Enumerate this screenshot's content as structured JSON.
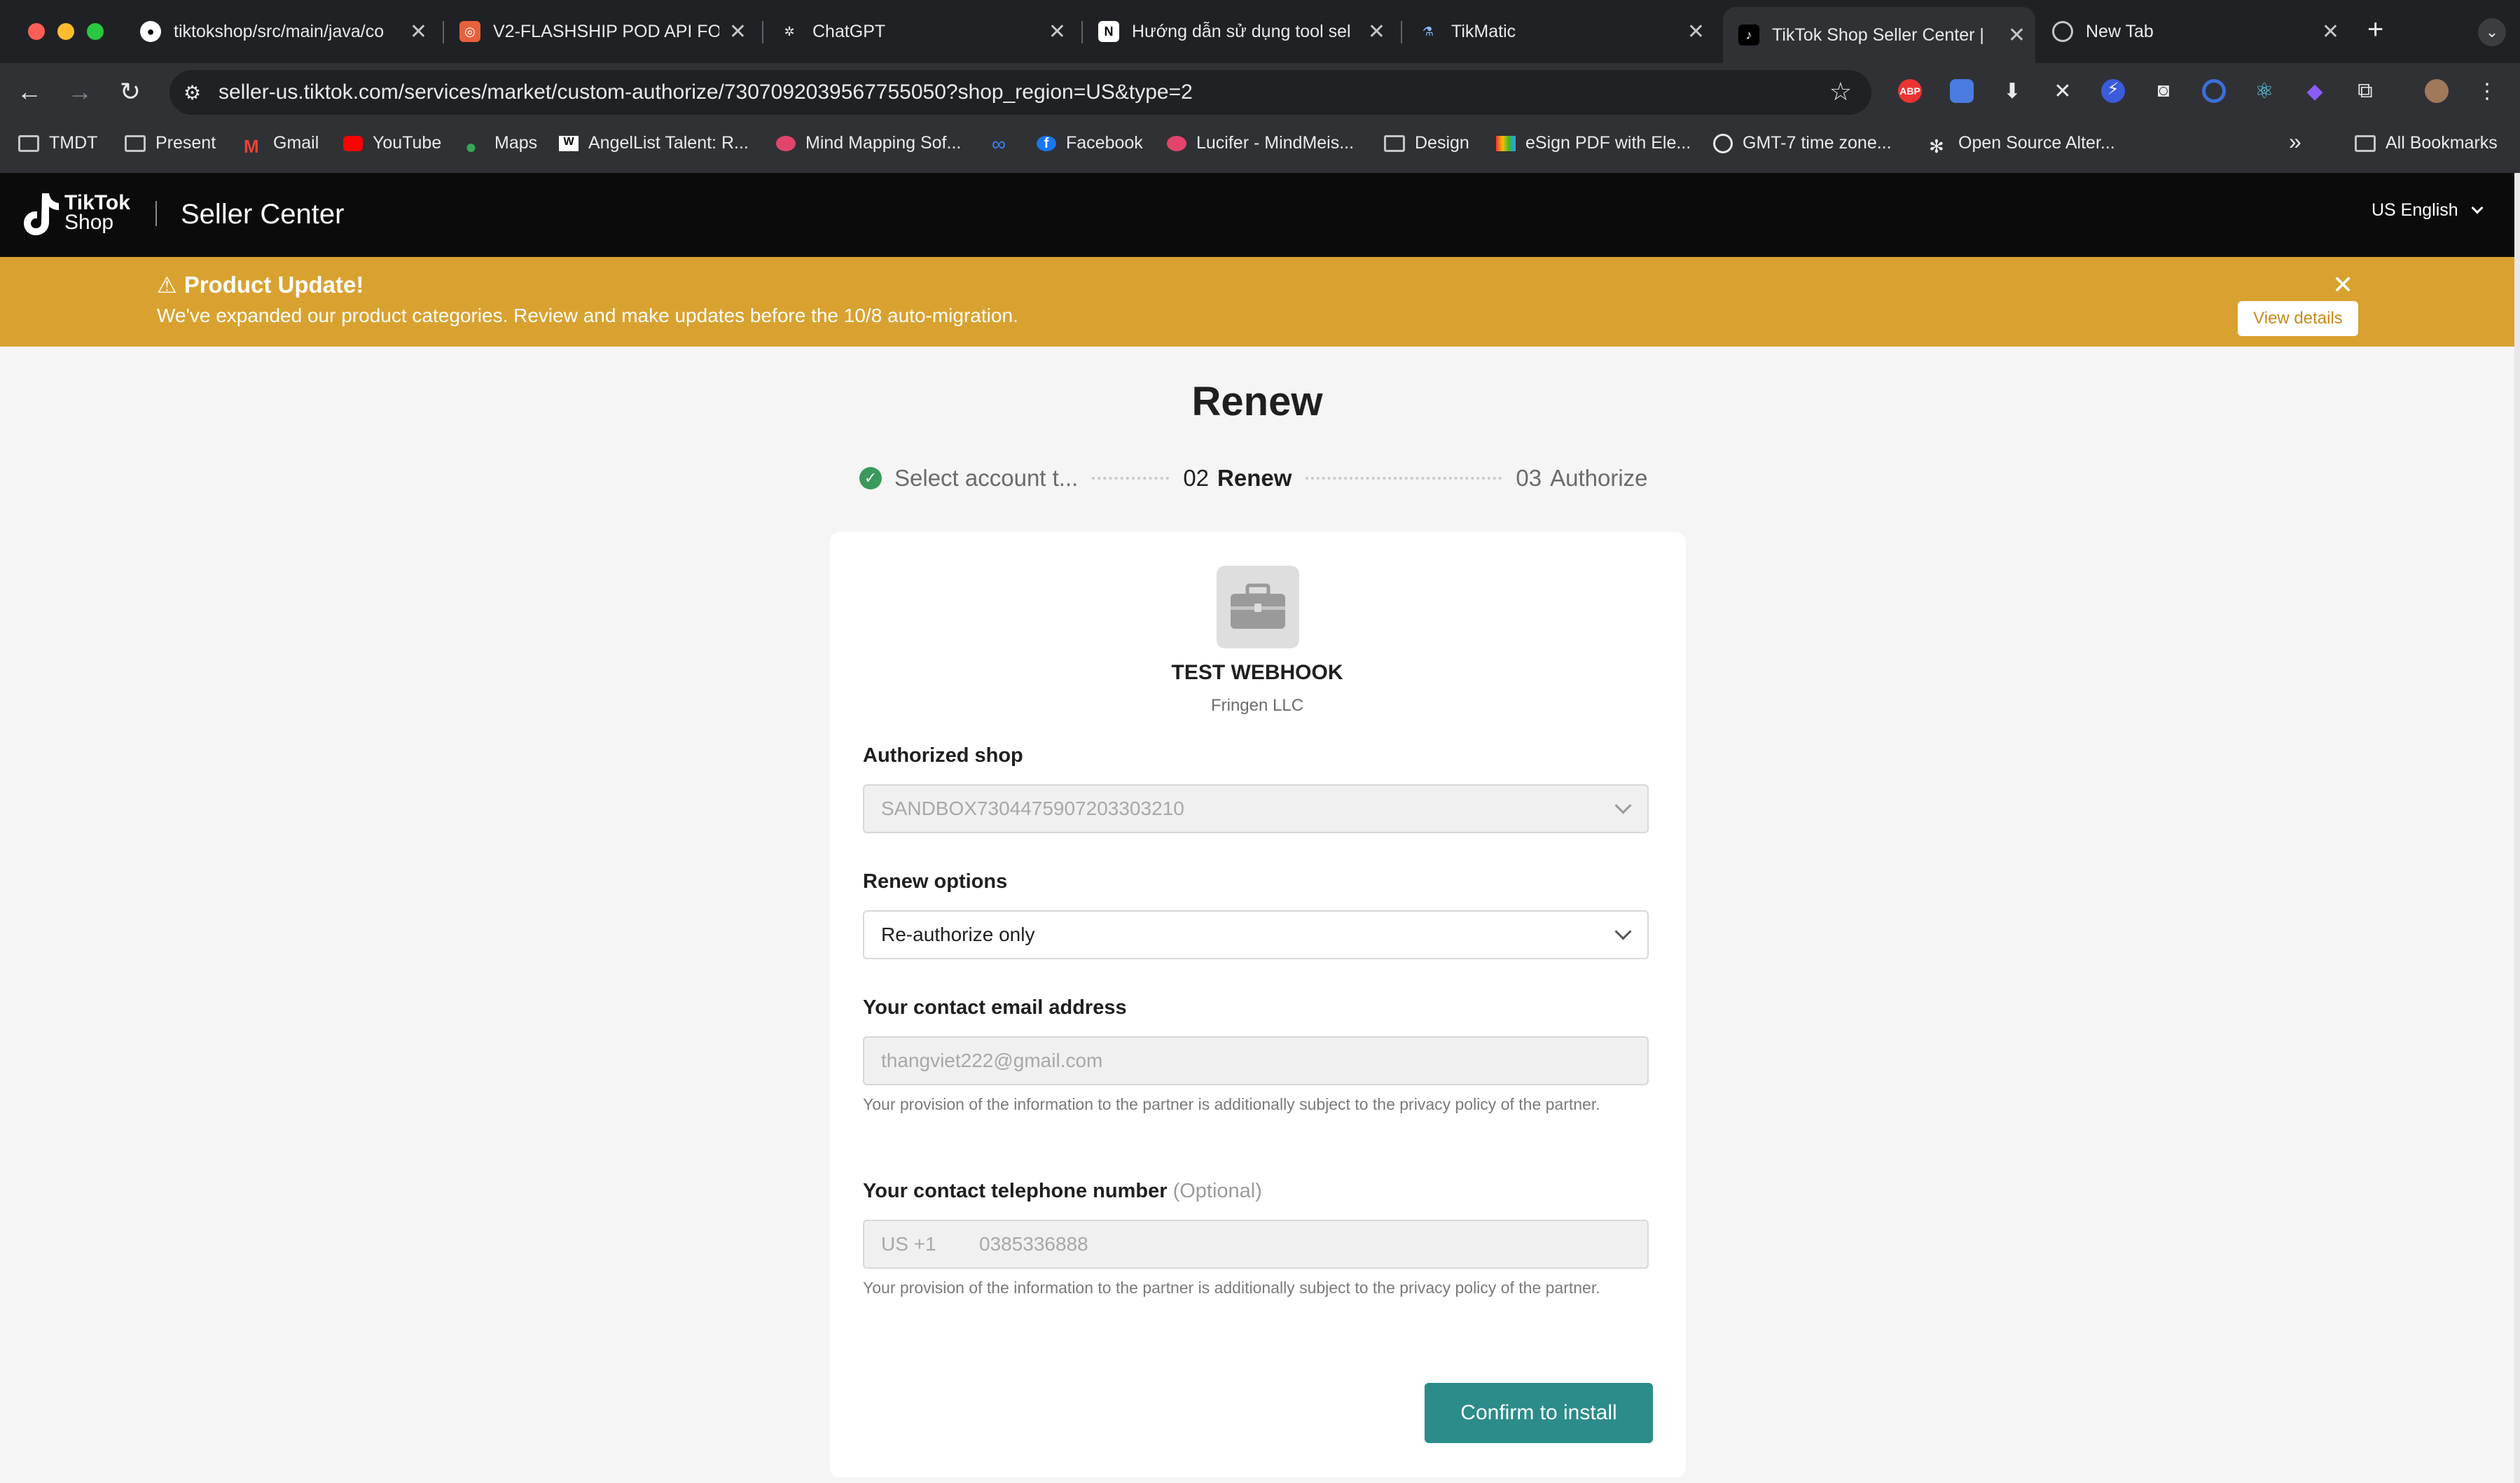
{
  "browser": {
    "tabs": [
      {
        "title": "tiktokshop/src/main/java/co",
        "active": false
      },
      {
        "title": "V2-FLASHSHIP POD API FO",
        "active": false
      },
      {
        "title": "ChatGPT",
        "active": false
      },
      {
        "title": "Hướng dẫn sử dụng tool sel",
        "active": false
      },
      {
        "title": "TikMatic",
        "active": false
      },
      {
        "title": "TikTok Shop Seller Center |",
        "active": true
      },
      {
        "title": "New Tab",
        "active": false
      }
    ],
    "new_tab": "+",
    "url": "seller-us.tiktok.com/services/market/custom-authorize/7307092039567755050?shop_region=US&type=2",
    "bookmarks": [
      {
        "label": "TMDT",
        "icon": "folder-icon"
      },
      {
        "label": "Present",
        "icon": "folder-icon"
      },
      {
        "label": "Gmail",
        "icon": "gmail-icon"
      },
      {
        "label": "YouTube",
        "icon": "youtube-icon"
      },
      {
        "label": "Maps",
        "icon": "maps-icon"
      },
      {
        "label": "AngelList Talent: R...",
        "icon": "angellist-icon"
      },
      {
        "label": "Mind Mapping Sof...",
        "icon": "mindmeister-icon"
      },
      {
        "label": "",
        "icon": "meta-icon"
      },
      {
        "label": "Facebook",
        "icon": "facebook-icon"
      },
      {
        "label": "Lucifer - MindMeis...",
        "icon": "mindmeister-icon"
      },
      {
        "label": "Design",
        "icon": "folder-icon"
      },
      {
        "label": "eSign PDF with Ele...",
        "icon": "esign-icon"
      },
      {
        "label": "GMT-7 time zone...",
        "icon": "clock-icon"
      },
      {
        "label": "Open Source Alter...",
        "icon": "opensource-icon"
      }
    ],
    "more_bookmarks": "»",
    "all_bookmarks": "All Bookmarks"
  },
  "header": {
    "logo_line1": "TikTok",
    "logo_line2": "Shop",
    "title": "Seller Center",
    "language": "US English"
  },
  "banner": {
    "title": "Product Update!",
    "text": "We've expanded our product categories. Review and make updates before the 10/8 auto-migration.",
    "button": "View details",
    "bg_color": "#d9a230"
  },
  "page": {
    "title": "Renew",
    "steps": [
      {
        "num": "",
        "label": "Select account t...",
        "state": "done"
      },
      {
        "num": "02",
        "label": "Renew",
        "state": "current"
      },
      {
        "num": "03",
        "label": "Authorize",
        "state": "pending"
      }
    ]
  },
  "shop": {
    "name": "TEST WEBHOOK",
    "company": "Fringen LLC"
  },
  "form": {
    "authorized_shop_label": "Authorized shop",
    "authorized_shop_value": "SANDBOX7304475907203303210",
    "renew_label": "Renew options",
    "renew_value": "Re-authorize only",
    "email_label": "Your contact email address",
    "email_value": "thangviet222@gmail.com",
    "email_help": "Your provision of the information to the partner is additionally subject to the privacy policy of the partner.",
    "phone_label": "Your contact telephone number",
    "phone_optional": "(Optional)",
    "phone_code": "US +1",
    "phone_value": "0385336888",
    "phone_help": "Your provision of the information to the partner is additionally subject to the privacy policy of the partner.",
    "confirm_label": "Confirm to install",
    "accent_color": "#2c8c8a"
  }
}
